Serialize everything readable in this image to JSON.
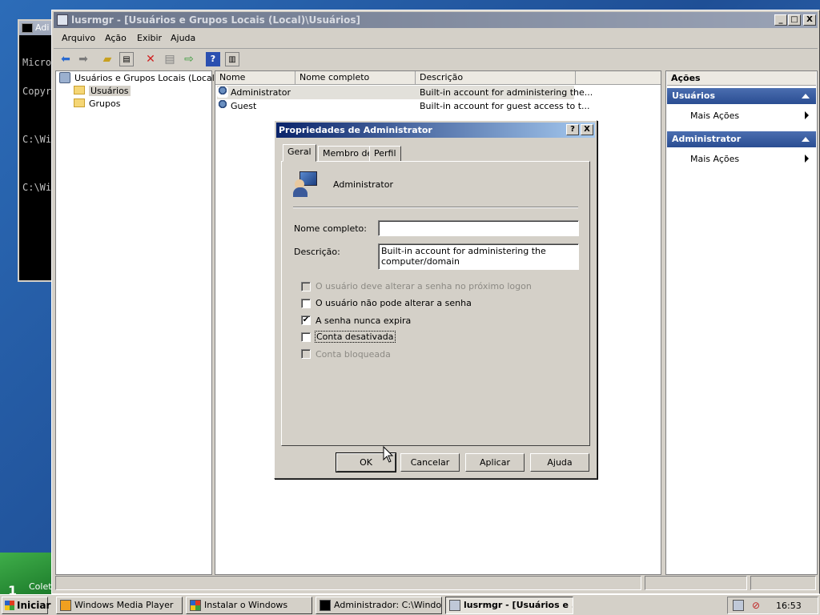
{
  "desktop": {
    "label": "Colet",
    "number": "1"
  },
  "cmd": {
    "title": "Adi",
    "lines": [
      "Micro",
      "Copyr",
      "",
      "C:\\Wi",
      "",
      "C:\\Wi"
    ]
  },
  "mmc": {
    "title": "lusrmgr - [Usuários e Grupos Locais (Local)\\Usuários]",
    "window_buttons": [
      "_",
      "□",
      "X"
    ],
    "menu": [
      "Arquivo",
      "Ação",
      "Exibir",
      "Ajuda"
    ],
    "toolbar": [
      "back-arrow-icon",
      "forward-arrow-icon",
      "up-folder-icon",
      "show-hide-tree-icon",
      "delete-icon",
      "properties-icon",
      "export-list-icon",
      "help-icon",
      "show-hide-action-pane-icon"
    ],
    "tree": {
      "root": "Usuários e Grupos Locais (Local)",
      "items": [
        "Usuários",
        "Grupos"
      ]
    },
    "list": {
      "columns": [
        "Nome",
        "Nome completo",
        "Descrição"
      ],
      "rows": [
        {
          "name": "Administrator",
          "full_name": "",
          "description": "Built-in account for administering the..."
        },
        {
          "name": "Guest",
          "full_name": "",
          "description": "Built-in account for guest access to t..."
        }
      ]
    },
    "actions": {
      "title": "Ações",
      "sections": [
        {
          "header": "Usuários",
          "item": "Mais Ações"
        },
        {
          "header": "Administrator",
          "item": "Mais Ações"
        }
      ]
    }
  },
  "dialog": {
    "title": "Propriedades de Administrator",
    "help_button": "?",
    "close_button": "X",
    "tabs": [
      "Geral",
      "Membro de",
      "Perfil"
    ],
    "active_tab": "Geral",
    "username": "Administrator",
    "full_name_label": "Nome completo:",
    "full_name_value": "",
    "description_label": "Descrição:",
    "description_value": "Built-in account for administering the computer/domain",
    "checkboxes": [
      {
        "label": "O usuário deve alterar a senha no próximo logon",
        "checked": false,
        "disabled": true
      },
      {
        "label": "O usuário não pode alterar a senha",
        "checked": false,
        "disabled": false
      },
      {
        "label": "A senha nunca expira",
        "checked": true,
        "disabled": false
      },
      {
        "label": "Conta desativada",
        "checked": false,
        "disabled": false
      },
      {
        "label": "Conta bloqueada",
        "checked": false,
        "disabled": true
      }
    ],
    "buttons": {
      "ok": "OK",
      "cancel": "Cancelar",
      "apply": "Aplicar",
      "help": "Ajuda"
    }
  },
  "taskbar": {
    "start": "Iniciar",
    "tasks": [
      {
        "label": "Windows Media Player",
        "icon": "media-player-icon"
      },
      {
        "label": "Instalar o Windows",
        "icon": "windows-setup-icon"
      },
      {
        "label": "Administrador: C:\\Windo...",
        "icon": "cmd-icon"
      },
      {
        "label": "lusrmgr - [Usuários e ...",
        "icon": "mmc-icon"
      }
    ],
    "clock": "16:53"
  }
}
